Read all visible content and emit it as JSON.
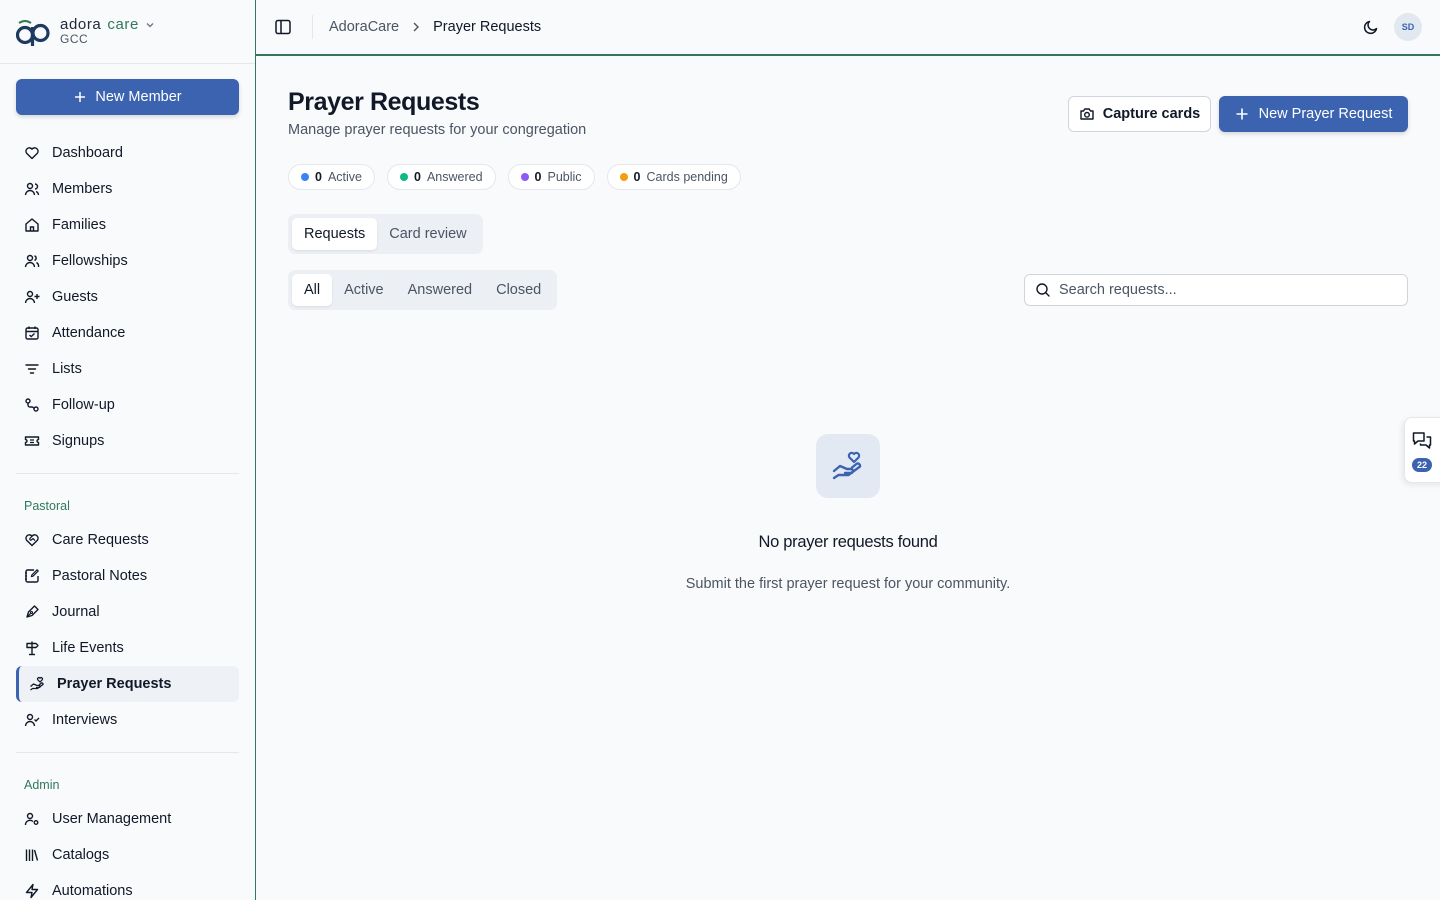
{
  "brand": {
    "name_prefix": "adora",
    "name_suffix": "care",
    "org": "GCC"
  },
  "sidebar": {
    "new_member_label": "New Member",
    "main_items": [
      {
        "label": "Dashboard",
        "icon": "heart-icon"
      },
      {
        "label": "Members",
        "icon": "users-icon"
      },
      {
        "label": "Families",
        "icon": "home-icon"
      },
      {
        "label": "Fellowships",
        "icon": "user-group-icon"
      },
      {
        "label": "Guests",
        "icon": "user-plus-icon"
      },
      {
        "label": "Attendance",
        "icon": "calendar-check-icon"
      },
      {
        "label": "Lists",
        "icon": "filter-icon"
      },
      {
        "label": "Follow-up",
        "icon": "route-icon"
      },
      {
        "label": "Signups",
        "icon": "ticket-icon"
      }
    ],
    "pastoral_heading": "Pastoral",
    "pastoral_items": [
      {
        "label": "Care Requests",
        "icon": "heart-handshake-icon"
      },
      {
        "label": "Pastoral Notes",
        "icon": "notebook-pen-icon"
      },
      {
        "label": "Journal",
        "icon": "pen-tool-icon"
      },
      {
        "label": "Life Events",
        "icon": "signpost-icon"
      },
      {
        "label": "Prayer Requests",
        "icon": "hand-heart-icon",
        "active": true
      },
      {
        "label": "Interviews",
        "icon": "user-check-icon"
      }
    ],
    "admin_heading": "Admin",
    "admin_items": [
      {
        "label": "User Management",
        "icon": "user-cog-icon"
      },
      {
        "label": "Catalogs",
        "icon": "library-icon"
      },
      {
        "label": "Automations",
        "icon": "zap-icon"
      }
    ]
  },
  "header": {
    "breadcrumb_root": "AdoraCare",
    "breadcrumb_current": "Prayer Requests",
    "avatar_initials": "SD"
  },
  "main": {
    "title": "Prayer Requests",
    "subtitle": "Manage prayer requests for your congregation",
    "capture_label": "Capture cards",
    "new_request_label": "New Prayer Request",
    "stats": [
      {
        "count": "0",
        "label": "Active",
        "color": "#3b82f6"
      },
      {
        "count": "0",
        "label": "Answered",
        "color": "#10b981"
      },
      {
        "count": "0",
        "label": "Public",
        "color": "#8b5cf6"
      },
      {
        "count": "0",
        "label": "Cards pending",
        "color": "#f59e0b"
      }
    ],
    "tabs": [
      "Requests",
      "Card review"
    ],
    "filters": [
      "All",
      "Active",
      "Answered",
      "Closed"
    ],
    "search_placeholder": "Search requests...",
    "empty_title": "No prayer requests found",
    "empty_subtitle": "Submit the first prayer request for your community."
  },
  "chat": {
    "badge_count": "22"
  },
  "colors": {
    "primary": "#3b63b0",
    "accent_green": "#2f7a5a"
  }
}
